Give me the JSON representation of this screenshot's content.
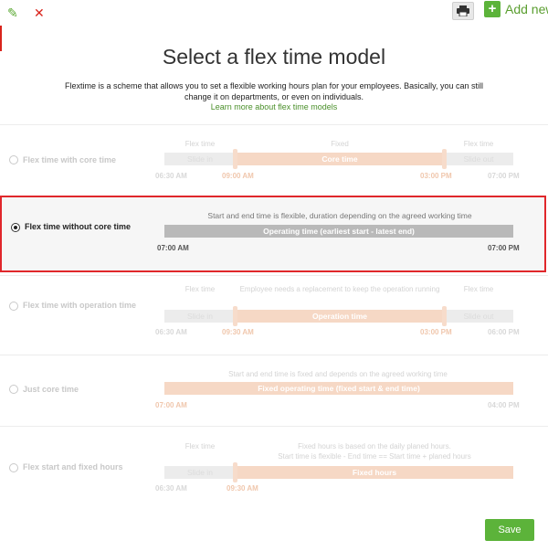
{
  "toolbar": {
    "edit_icon": "pencil-icon",
    "close_icon": "close-icon",
    "print_icon": "printer-icon",
    "add_icon": "plus-icon",
    "add_label": "Add new"
  },
  "colors": {
    "accent_green": "#5cb33a",
    "link_green": "#4a8f2a",
    "selection_red": "#e0272b",
    "peach": "#f6d8c5"
  },
  "page": {
    "title": "Select a flex time model",
    "intro": "Flextime is a scheme that allows you to set a flexible working hours plan for your employees. Basically, you can still change it on departments, or even on individuals.",
    "learn_more": "Learn more about flex time models"
  },
  "models": [
    {
      "label": "Flex time with core time",
      "selected": false,
      "headers": [
        "Flex time",
        "Fixed",
        "Flex time"
      ],
      "bars": [
        "Slide in",
        "Core time",
        "Slide out"
      ],
      "times": [
        "06:30 AM",
        "09:00 AM",
        "03:00 PM",
        "07:00 PM"
      ]
    },
    {
      "label": "Flex time without core time",
      "selected": true,
      "headers": [
        "Start and end time is flexible, duration depending on the agreed working time"
      ],
      "bars": [
        "Operating time (earliest start - latest end)"
      ],
      "times": [
        "07:00 AM",
        "07:00 PM"
      ]
    },
    {
      "label": "Flex time with operation time",
      "selected": false,
      "headers": [
        "Flex time",
        "Employee needs a replacement to keep the operation running",
        "Flex time"
      ],
      "bars": [
        "Slide in",
        "Operation time",
        "Slide out"
      ],
      "times": [
        "06:30 AM",
        "09:30 AM",
        "03:00 PM",
        "06:00 PM"
      ]
    },
    {
      "label": "Just core time",
      "selected": false,
      "headers": [
        "Start and end time is fixed and depends on the agreed working time"
      ],
      "bars": [
        "Fixed operating time (fixed start & end time)"
      ],
      "times": [
        "07:00 AM",
        "04:00 PM"
      ]
    },
    {
      "label": "Flex start and fixed hours",
      "selected": false,
      "headers": [
        "Flex time",
        "Fixed hours is based on the daily planed hours.",
        "Start time is flexible - End time == Start time + planed hours"
      ],
      "bars": [
        "Slide in",
        "Fixed hours"
      ],
      "times": [
        "06:30 AM",
        "09:30 AM"
      ]
    }
  ],
  "footer": {
    "save_label": "Save"
  }
}
